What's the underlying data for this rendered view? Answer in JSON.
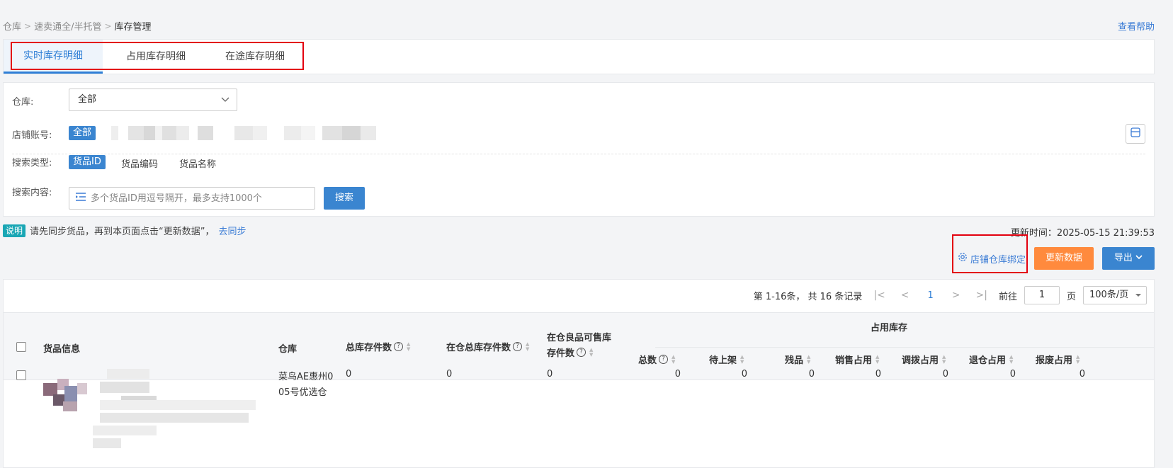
{
  "breadcrumb": {
    "items": [
      "仓库",
      "速卖通全/半托管",
      "库存管理"
    ],
    "separator": ">"
  },
  "help_link": "查看帮助",
  "tabs": [
    {
      "label": "实时库存明细",
      "active": true
    },
    {
      "label": "占用库存明细",
      "active": false
    },
    {
      "label": "在途库存明细",
      "active": false
    }
  ],
  "filters": {
    "warehouse_label": "仓库:",
    "warehouse_value": "全部",
    "shop_label": "店铺账号:",
    "shop_all": "全部",
    "search_type_label": "搜索类型:",
    "search_types": [
      "货品ID",
      "货品编码",
      "货品名称"
    ],
    "search_content_label": "搜索内容:",
    "search_placeholder": "多个货品ID用逗号隔开，最多支持1000个",
    "search_button": "搜索"
  },
  "note": {
    "tag": "说明",
    "text": "请先同步货品，再到本页面点击“更新数据”，",
    "link": "去同步"
  },
  "update_time": "更新时间：2025-05-15 21:39:53",
  "actions": {
    "bind": "店铺仓库绑定",
    "refresh": "更新数据",
    "export": "导出"
  },
  "pager": {
    "summary": "第 1-16条， 共 16 条记录",
    "current_page": "1",
    "goto_label": "前往",
    "goto_value": "1",
    "page_unit": "页",
    "page_size": "100条/页"
  },
  "table": {
    "headers": {
      "product": "货品信息",
      "warehouse": "仓库",
      "total": "总库存件数",
      "in_wh_total": "在仓总库存件数",
      "sellable_line1": "在仓良品可售库",
      "sellable_line2": "存件数",
      "occupied_group": "占用库存",
      "occ_total": "总数",
      "pending_shelf": "待上架",
      "defective": "残品",
      "sales_occ": "销售占用",
      "transfer_occ": "调拨占用",
      "return_occ": "退仓占用",
      "scrap_occ": "报废占用"
    },
    "rows": [
      {
        "warehouse_line1": "菜鸟AE惠州0",
        "warehouse_line2": "05号优选仓",
        "total": "0",
        "in_wh_total": "0",
        "sellable": "0",
        "occ_total": "0",
        "pending_shelf": "0",
        "defective": "0",
        "sales_occ": "0",
        "transfer_occ": "0",
        "return_occ": "0",
        "scrap_occ": "0"
      }
    ]
  },
  "colors": {
    "primary": "#3a85d0",
    "orange": "#ff8a3d",
    "highlight": "#e3000f",
    "note_tag": "#19a6b4"
  }
}
